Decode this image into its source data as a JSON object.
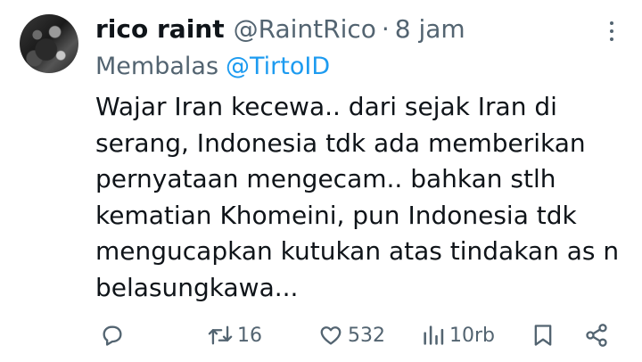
{
  "tweet": {
    "display_name": "rico raint",
    "handle": "@RaintRico",
    "separator": "·",
    "time": "8 jam",
    "reply_prefix": "Membalas",
    "reply_mention": "@TirtoID",
    "text_lines": [
      "Wajar Iran kecewa.. dari sejak Iran di",
      "serang, Indonesia tdk ada memberikan",
      "pernyataan mengecam.. bahkan stlh",
      "kematian Khomeini, pun Indonesia tdk",
      "mengucapkan kutukan atas tindakan as n",
      "belasungkawa..."
    ]
  },
  "actions": {
    "reply": {
      "icon": "reply-icon",
      "count": ""
    },
    "retweet": {
      "icon": "retweet-icon",
      "count": "16"
    },
    "like": {
      "icon": "heart-icon",
      "count": "532"
    },
    "views": {
      "icon": "views-icon",
      "count": "10rb"
    },
    "bookmark": {
      "icon": "bookmark-icon"
    },
    "share": {
      "icon": "share-icon"
    }
  },
  "colors": {
    "text": "#0f1419",
    "secondary": "#536471",
    "link": "#1d9bf0",
    "background": "#ffffff"
  }
}
